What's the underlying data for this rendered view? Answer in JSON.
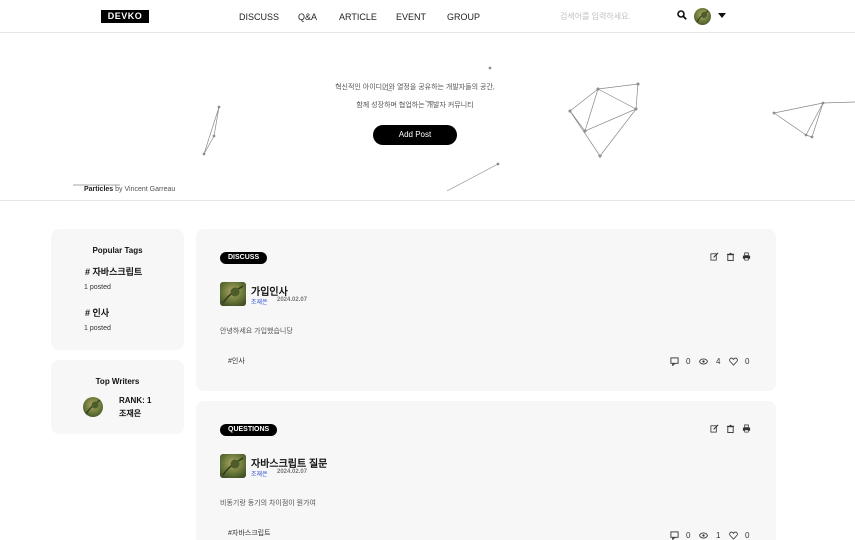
{
  "header": {
    "logo": "DEVKO",
    "nav": [
      "DISCUSS",
      "Q&A",
      "ARTICLE",
      "EVENT",
      "GROUP"
    ],
    "search_placeholder": "검색어를 입력하세요."
  },
  "hero": {
    "line1": "혁신적인 아이디어와 열정을 공유하는 개발자들의 공간,",
    "line2": "함께 성장하며 협업하는 개발자 커뮤니티",
    "add_post": "Add Post",
    "credit_bold": "Particles",
    "credit_rest": " by Vincent Garreau"
  },
  "sidebar": {
    "popular_title": "Popular Tags",
    "tags": [
      {
        "name": "# 자바스크립트",
        "count": "1 posted"
      },
      {
        "name": "# 인사",
        "count": "1 posted"
      }
    ],
    "writers_title": "Top Writers",
    "writer": {
      "rank": "RANK: 1",
      "name": "조재은"
    }
  },
  "posts": [
    {
      "badge": "DISCUSS",
      "title": "가입인사",
      "author": "조재은",
      "date": "2024.02.07",
      "body": "안녕하세요 가입했습니당",
      "tag": "#인사",
      "comments": "0",
      "views": "4",
      "likes": "0"
    },
    {
      "badge": "QUESTIONS",
      "title": "자바스크립트 질문",
      "author": "조재은",
      "date": "2024.02.07",
      "body": "비동기랑 동기의 차이점이 뭔가여",
      "tag": "#자바스크립트",
      "comments": "0",
      "views": "1",
      "likes": "0"
    }
  ],
  "icons": {
    "search": "search-icon",
    "edit": "edit-icon",
    "delete": "trash-icon",
    "print": "print-icon",
    "comment": "comment-icon",
    "view": "eye-icon",
    "like": "heart-icon"
  }
}
